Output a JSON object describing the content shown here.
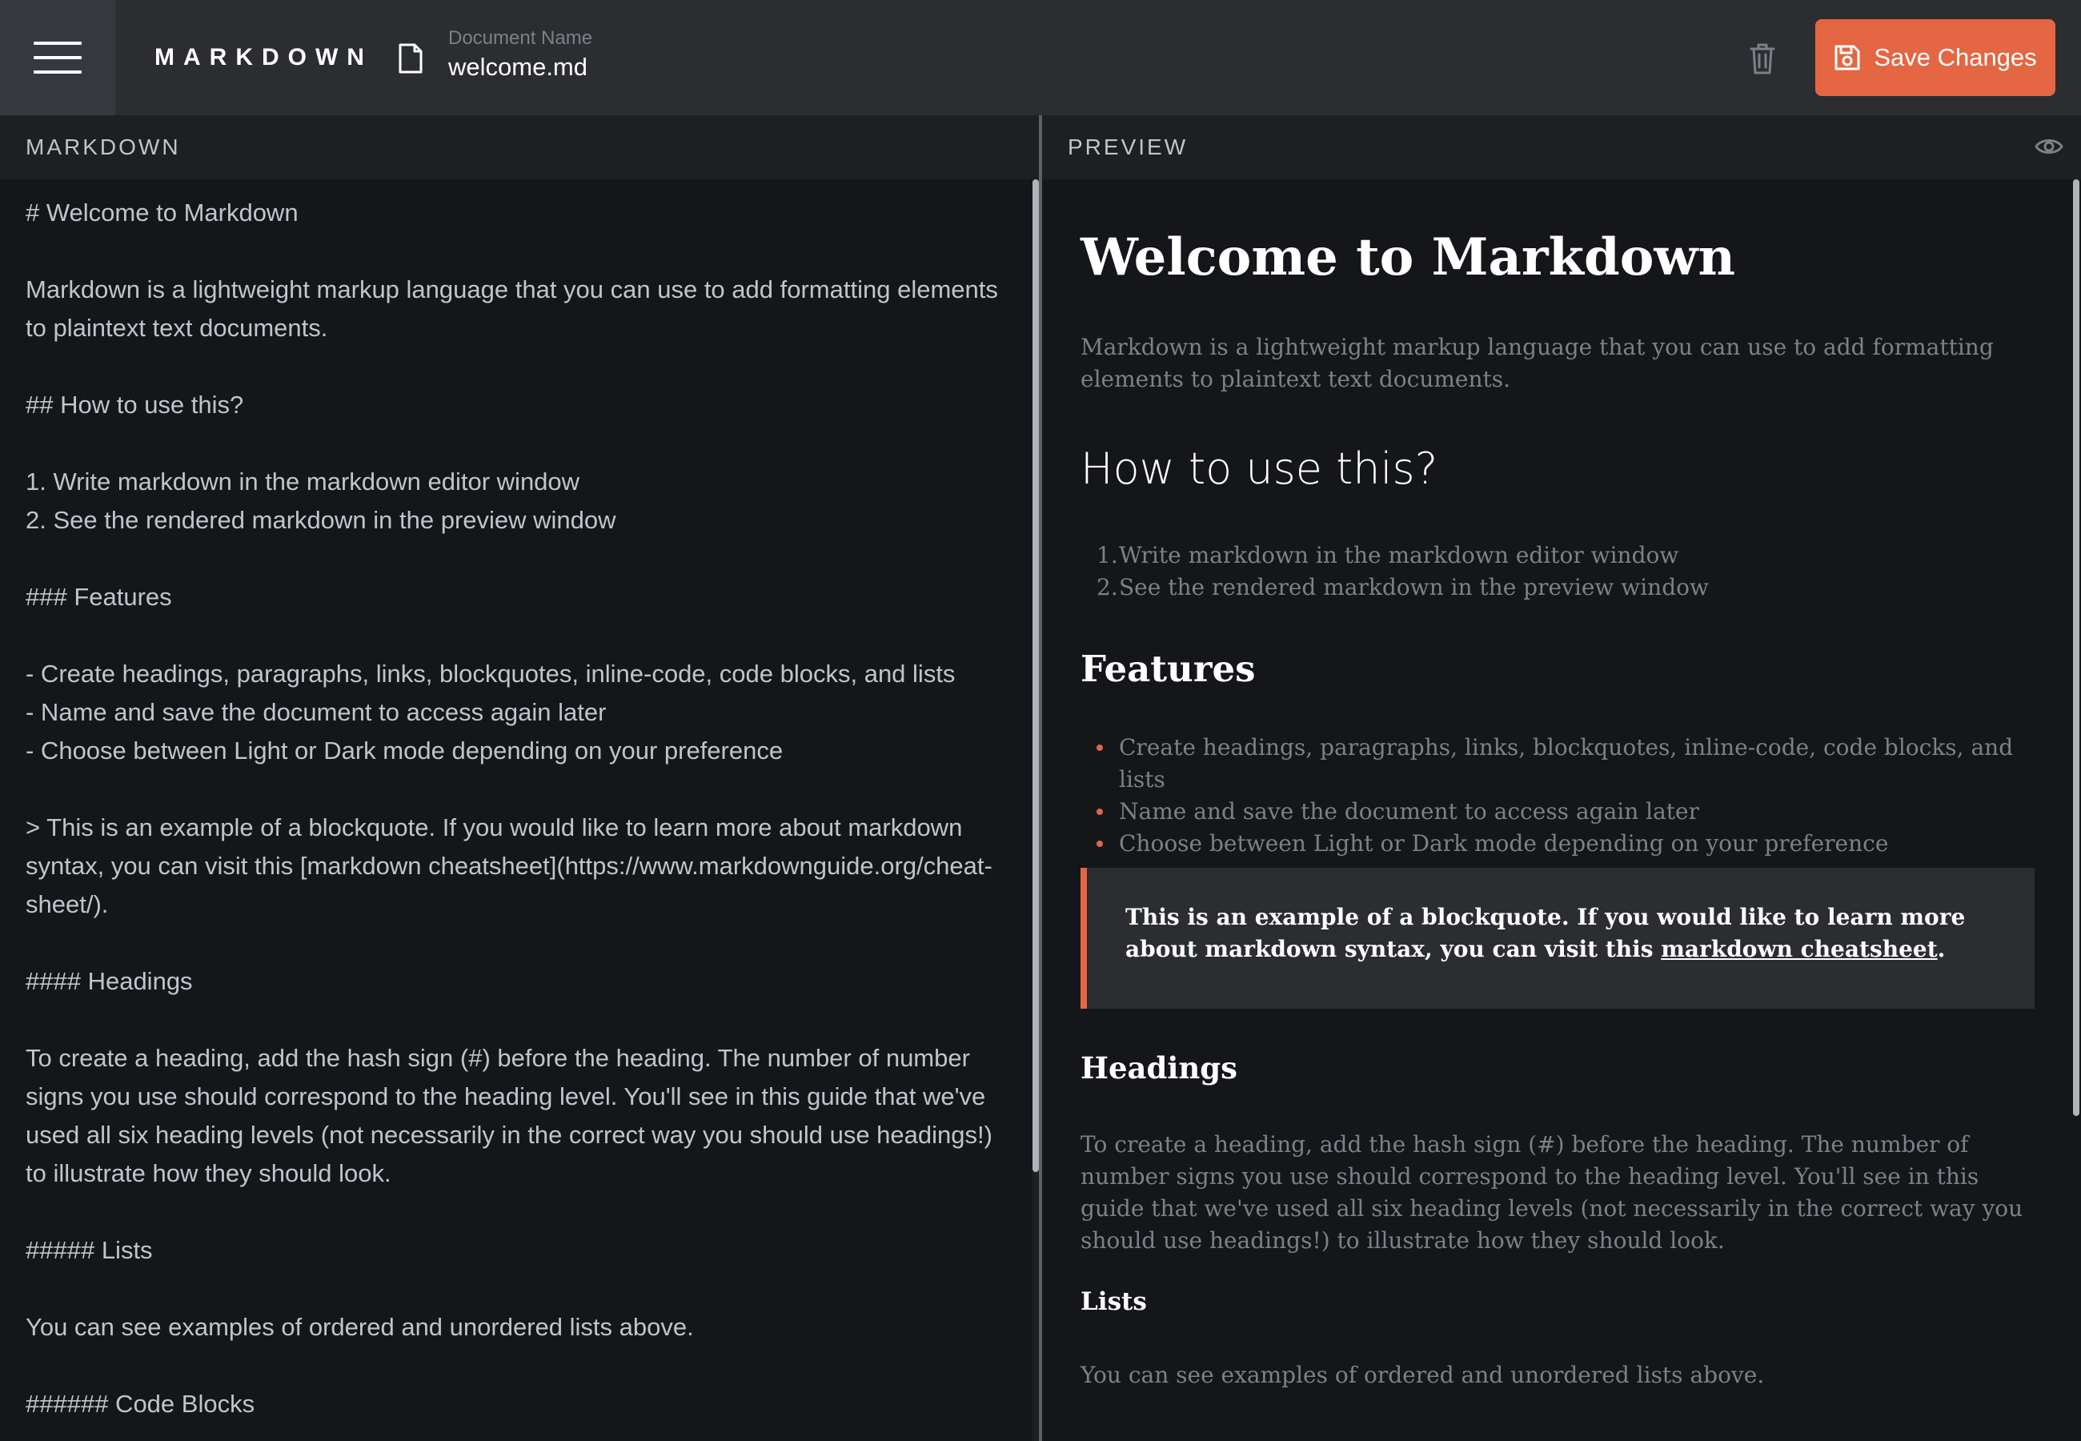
{
  "header": {
    "brand": "MARKDOWN",
    "document_label": "Document Name",
    "document_name": "welcome.md",
    "save_label": "Save Changes"
  },
  "editor": {
    "title": "MARKDOWN",
    "source": "# Welcome to Markdown\n\nMarkdown is a lightweight markup language that you can use to add formatting elements to plaintext text documents.\n\n## How to use this?\n\n1. Write markdown in the markdown editor window\n2. See the rendered markdown in the preview window\n\n### Features\n\n- Create headings, paragraphs, links, blockquotes, inline-code, code blocks, and lists\n- Name and save the document to access again later\n- Choose between Light or Dark mode depending on your preference\n\n> This is an example of a blockquote. If you would like to learn more about markdown syntax, you can visit this [markdown cheatsheet](https://www.markdownguide.org/cheat-sheet/).\n\n#### Headings\n\nTo create a heading, add the hash sign (#) before the heading. The number of number signs you use should correspond to the heading level. You'll see in this guide that we've used all six heading levels (not necessarily in the correct way you should use headings!) to illustrate how they should look.\n\n##### Lists\n\nYou can see examples of ordered and unordered lists above.\n\n###### Code Blocks"
  },
  "preview": {
    "title": "PREVIEW",
    "h1": "Welcome to Markdown",
    "intro": "Markdown is a lightweight markup language that you can use to add formatting elements to plaintext text documents.",
    "h2": "How to use this?",
    "ordered_list": [
      {
        "num": "1.",
        "text": "Write markdown in the markdown editor window"
      },
      {
        "num": "2.",
        "text": "See the rendered markdown in the preview window"
      }
    ],
    "h3": "Features",
    "unordered_list": [
      "Create headings, paragraphs, links, blockquotes, inline-code, code blocks, and lists",
      "Name and save the document to access again later",
      "Choose between Light or Dark mode depending on your preference"
    ],
    "blockquote": {
      "text_before": "This is an example of a blockquote. If you would like to learn more about markdown syntax, you can visit this ",
      "link_text": "markdown cheatsheet",
      "text_after": "."
    },
    "h4": "Headings",
    "headings_paragraph": "To create a heading, add the hash sign (#) before the heading. The number of number signs you use should correspond to the heading level. You'll see in this guide that we've used all six heading levels (not necessarily in the correct way you should use headings!) to illustrate how they should look.",
    "h5": "Lists",
    "lists_paragraph": "You can see examples of ordered and unordered lists above."
  },
  "colors": {
    "accent": "#e46643",
    "header_bg": "#2b2d31",
    "panel_bg": "#151619",
    "panel_head_bg": "#1d1f22"
  },
  "icons": [
    "menu-icon",
    "document-icon",
    "trash-icon",
    "save-icon",
    "eye-icon"
  ]
}
